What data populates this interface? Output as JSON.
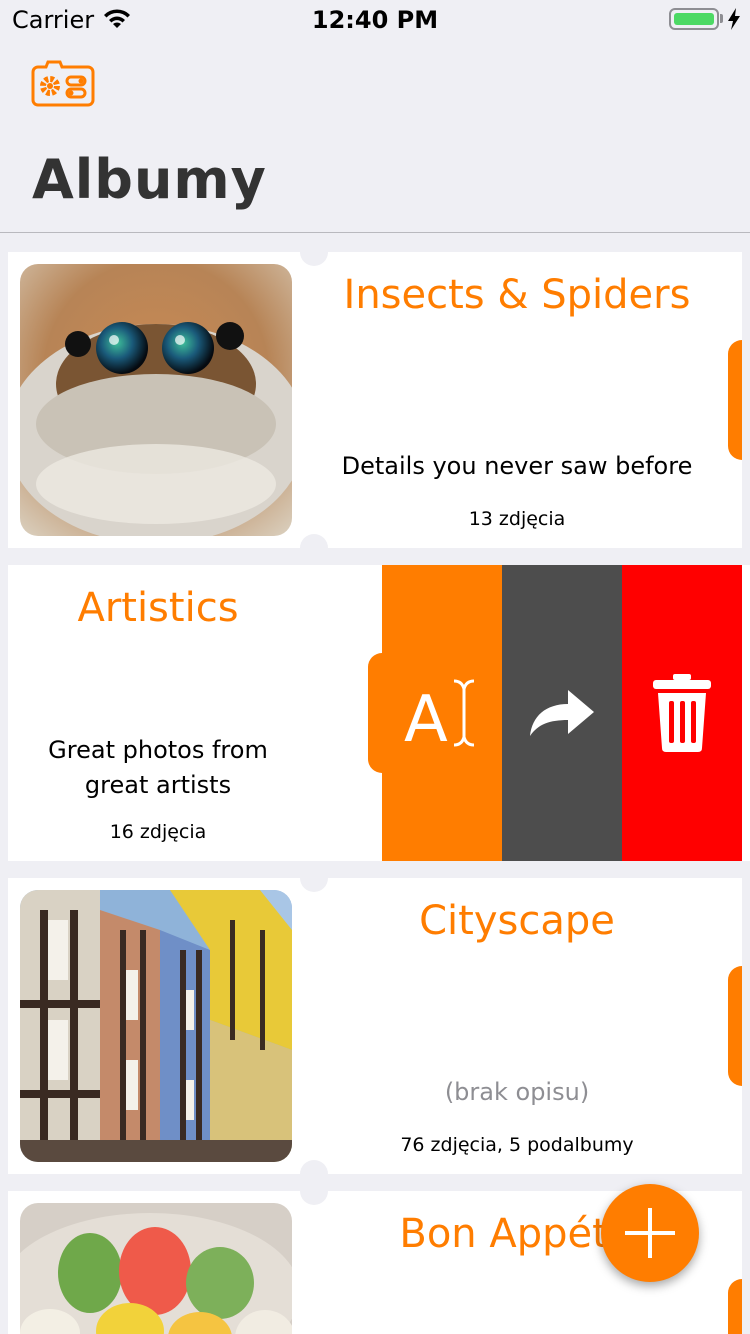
{
  "status_bar": {
    "carrier": "Carrier",
    "time": "12:40 PM",
    "battery_level": 1.0
  },
  "header": {
    "title": "Albumy",
    "settings_icon": "camera-settings-icon"
  },
  "albums": [
    {
      "title": "Insects & Spiders",
      "description": "Details you never saw before",
      "count": "13 zdjęcia"
    },
    {
      "title": "Artistics",
      "description_line1": "Great photos from",
      "description_line2": "great artists",
      "count": "16 zdjęcia"
    },
    {
      "title": "Cityscape",
      "description": "(brak opisu)",
      "count": "76 zdjęcia, 5 podalbumy"
    },
    {
      "title": "Bon Appétit"
    }
  ],
  "swipe_actions": [
    {
      "name": "rename",
      "icon": "rename-text-cursor-icon",
      "color": "#ff7d00"
    },
    {
      "name": "share",
      "icon": "share-arrow-icon",
      "color": "#4d4d4d"
    },
    {
      "name": "delete",
      "icon": "trash-icon",
      "color": "#ff0000"
    }
  ],
  "fab": {
    "icon": "plus-icon"
  },
  "colors": {
    "accent": "#ff7d00",
    "background": "#efeff4",
    "title": "#333333"
  }
}
